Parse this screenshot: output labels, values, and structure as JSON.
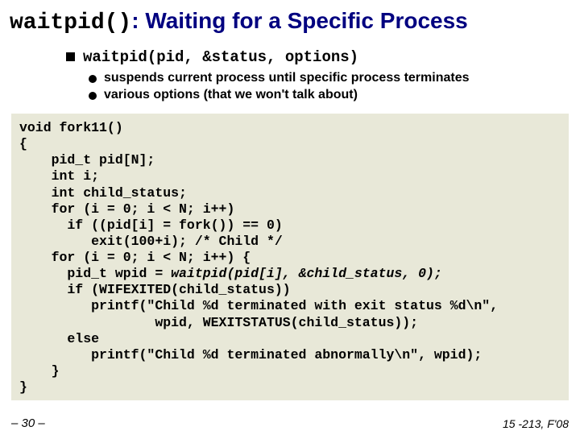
{
  "title": {
    "mono": "waitpid()",
    "rest": ": Waiting for a Specific Process"
  },
  "bullets": {
    "main": "waitpid(pid, &status, options)",
    "sub1": "suspends current process until specific process terminates",
    "sub2": "various options (that we won't talk about)"
  },
  "code": "void fork11()\n{\n    pid_t pid[N];\n    int i;\n    int child_status;\n    for (i = 0; i < N; i++)\n      if ((pid[i] = fork()) == 0)\n         exit(100+i); /* Child */\n    for (i = 0; i < N; i++) {\n      pid_t wpid = waitpid(pid[i], &child_status, 0);\n      if (WIFEXITED(child_status))\n         printf(\"Child %d terminated with exit status %d\\n\",\n                 wpid, WEXITSTATUS(child_status));\n      else\n         printf(\"Child %d terminated abnormally\\n\", wpid);\n    }\n}",
  "footer": {
    "left": "– 30 –",
    "right": "15 -213, F'08"
  }
}
